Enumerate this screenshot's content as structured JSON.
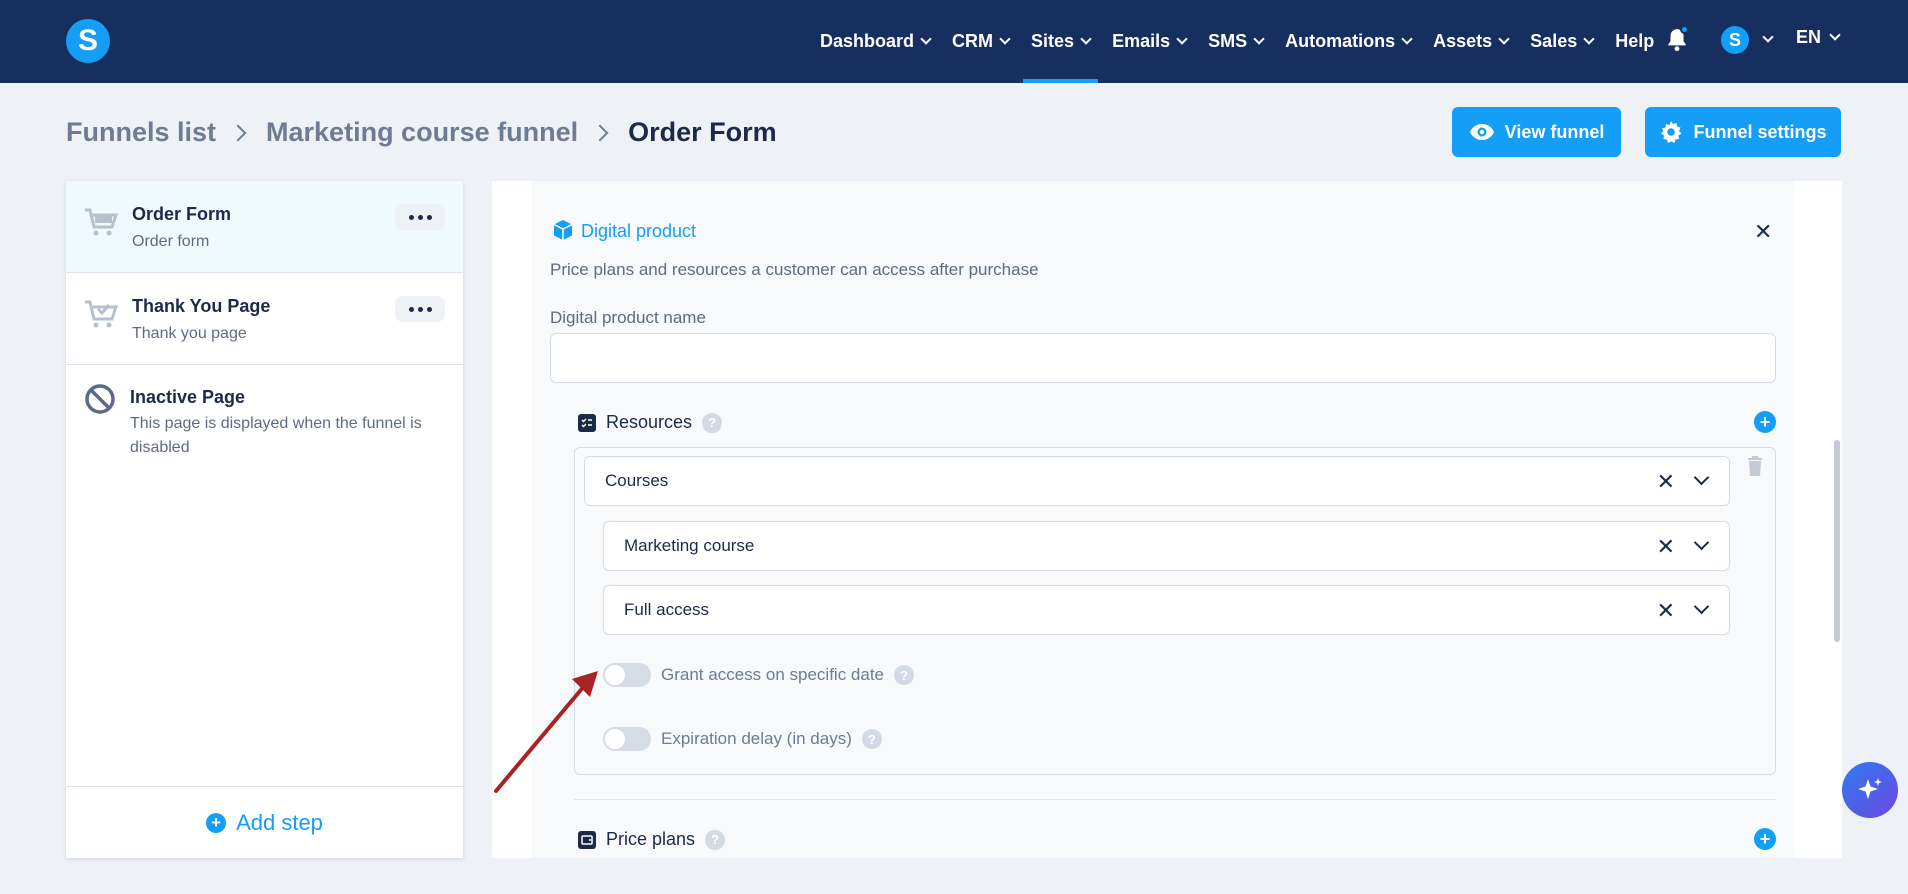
{
  "header": {
    "logo_letter": "S",
    "nav": [
      {
        "label": "Dashboard",
        "has_dropdown": true,
        "active": false
      },
      {
        "label": "CRM",
        "has_dropdown": true,
        "active": false
      },
      {
        "label": "Sites",
        "has_dropdown": true,
        "active": true
      },
      {
        "label": "Emails",
        "has_dropdown": true,
        "active": false
      },
      {
        "label": "SMS",
        "has_dropdown": true,
        "active": false
      },
      {
        "label": "Automations",
        "has_dropdown": true,
        "active": false
      },
      {
        "label": "Assets",
        "has_dropdown": true,
        "active": false
      },
      {
        "label": "Sales",
        "has_dropdown": true,
        "active": false
      },
      {
        "label": "Help",
        "has_dropdown": false,
        "active": false
      }
    ],
    "avatar_letter": "S",
    "language": "EN"
  },
  "breadcrumb": {
    "items": [
      "Funnels list",
      "Marketing course funnel",
      "Order Form"
    ]
  },
  "actions": {
    "view_funnel": "View funnel",
    "funnel_settings": "Funnel settings"
  },
  "steps": [
    {
      "title": "Order Form",
      "subtitle": "Order form",
      "active": true
    },
    {
      "title": "Thank You Page",
      "subtitle": "Thank you page",
      "active": false
    },
    {
      "title": "Inactive Page",
      "subtitle": "This page is displayed when the funnel is disabled",
      "active": false
    }
  ],
  "add_step": "Add step",
  "digital_product": {
    "title": "Digital product",
    "description": "Price plans and resources a customer can access after purchase",
    "name_label": "Digital product name",
    "name_value": "",
    "resources_label": "Resources",
    "resource_type": "Courses",
    "course": "Marketing course",
    "access": "Full access",
    "grant_access_label": "Grant access on specific date",
    "grant_access_on": false,
    "expiration_label": "Expiration delay (in days)",
    "expiration_on": false,
    "price_plans_label": "Price plans"
  },
  "colors": {
    "navbar": "#172f5f",
    "accent": "#149ef5",
    "arrow": "#a82424"
  }
}
